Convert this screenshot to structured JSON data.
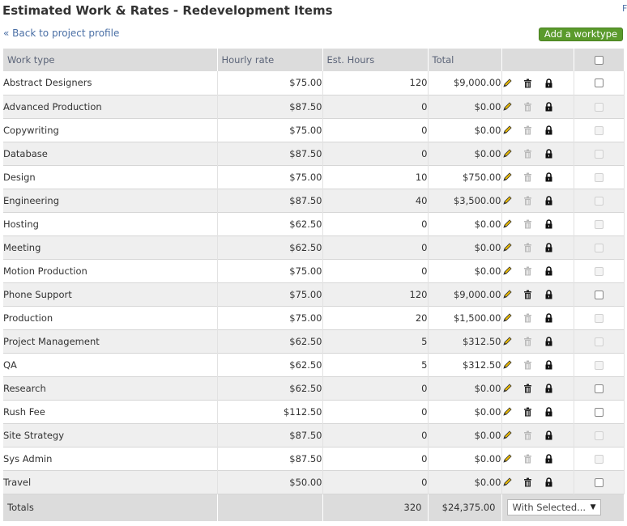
{
  "page": {
    "title": "Estimated Work & Rates - Redevelopment Items",
    "corner_link": "F",
    "back_link": "« Back to project profile",
    "add_button": "Add a worktype"
  },
  "table": {
    "headers": {
      "work_type": "Work type",
      "hourly_rate": "Hourly rate",
      "est_hours": "Est. Hours",
      "total": "Total"
    },
    "rows": [
      {
        "name": "Abstract Designers",
        "rate": "$75.00",
        "hours": "120",
        "total": "$9,000.00",
        "deletable": true,
        "selectable": true
      },
      {
        "name": "Advanced Production",
        "rate": "$87.50",
        "hours": "0",
        "total": "$0.00",
        "deletable": false,
        "selectable": false
      },
      {
        "name": "Copywriting",
        "rate": "$75.00",
        "hours": "0",
        "total": "$0.00",
        "deletable": false,
        "selectable": false
      },
      {
        "name": "Database",
        "rate": "$87.50",
        "hours": "0",
        "total": "$0.00",
        "deletable": false,
        "selectable": false
      },
      {
        "name": "Design",
        "rate": "$75.00",
        "hours": "10",
        "total": "$750.00",
        "deletable": false,
        "selectable": false
      },
      {
        "name": "Engineering",
        "rate": "$87.50",
        "hours": "40",
        "total": "$3,500.00",
        "deletable": false,
        "selectable": false
      },
      {
        "name": "Hosting",
        "rate": "$62.50",
        "hours": "0",
        "total": "$0.00",
        "deletable": false,
        "selectable": false
      },
      {
        "name": "Meeting",
        "rate": "$62.50",
        "hours": "0",
        "total": "$0.00",
        "deletable": false,
        "selectable": false
      },
      {
        "name": "Motion Production",
        "rate": "$75.00",
        "hours": "0",
        "total": "$0.00",
        "deletable": false,
        "selectable": false
      },
      {
        "name": "Phone Support",
        "rate": "$75.00",
        "hours": "120",
        "total": "$9,000.00",
        "deletable": true,
        "selectable": true
      },
      {
        "name": "Production",
        "rate": "$75.00",
        "hours": "20",
        "total": "$1,500.00",
        "deletable": false,
        "selectable": false
      },
      {
        "name": "Project Management",
        "rate": "$62.50",
        "hours": "5",
        "total": "$312.50",
        "deletable": false,
        "selectable": false
      },
      {
        "name": "QA",
        "rate": "$62.50",
        "hours": "5",
        "total": "$312.50",
        "deletable": false,
        "selectable": false
      },
      {
        "name": "Research",
        "rate": "$62.50",
        "hours": "0",
        "total": "$0.00",
        "deletable": true,
        "selectable": true
      },
      {
        "name": "Rush Fee",
        "rate": "$112.50",
        "hours": "0",
        "total": "$0.00",
        "deletable": true,
        "selectable": true
      },
      {
        "name": "Site Strategy",
        "rate": "$87.50",
        "hours": "0",
        "total": "$0.00",
        "deletable": false,
        "selectable": false
      },
      {
        "name": "Sys Admin",
        "rate": "$87.50",
        "hours": "0",
        "total": "$0.00",
        "deletable": false,
        "selectable": false
      },
      {
        "name": "Travel",
        "rate": "$50.00",
        "hours": "0",
        "total": "$0.00",
        "deletable": true,
        "selectable": true
      }
    ],
    "footer": {
      "label": "Totals",
      "hours": "320",
      "total": "$24,375.00",
      "with_selected": "With Selected..."
    }
  },
  "icons": {
    "edit": "pencil-icon",
    "delete": "trash-icon",
    "lock": "lock-icon",
    "dropdown": "chevron-down-icon"
  },
  "colors": {
    "accent_button": "#5a9a2c",
    "link": "#4a6fa5",
    "header_bg": "#dcdcdc",
    "pencil": "#e8b800"
  }
}
